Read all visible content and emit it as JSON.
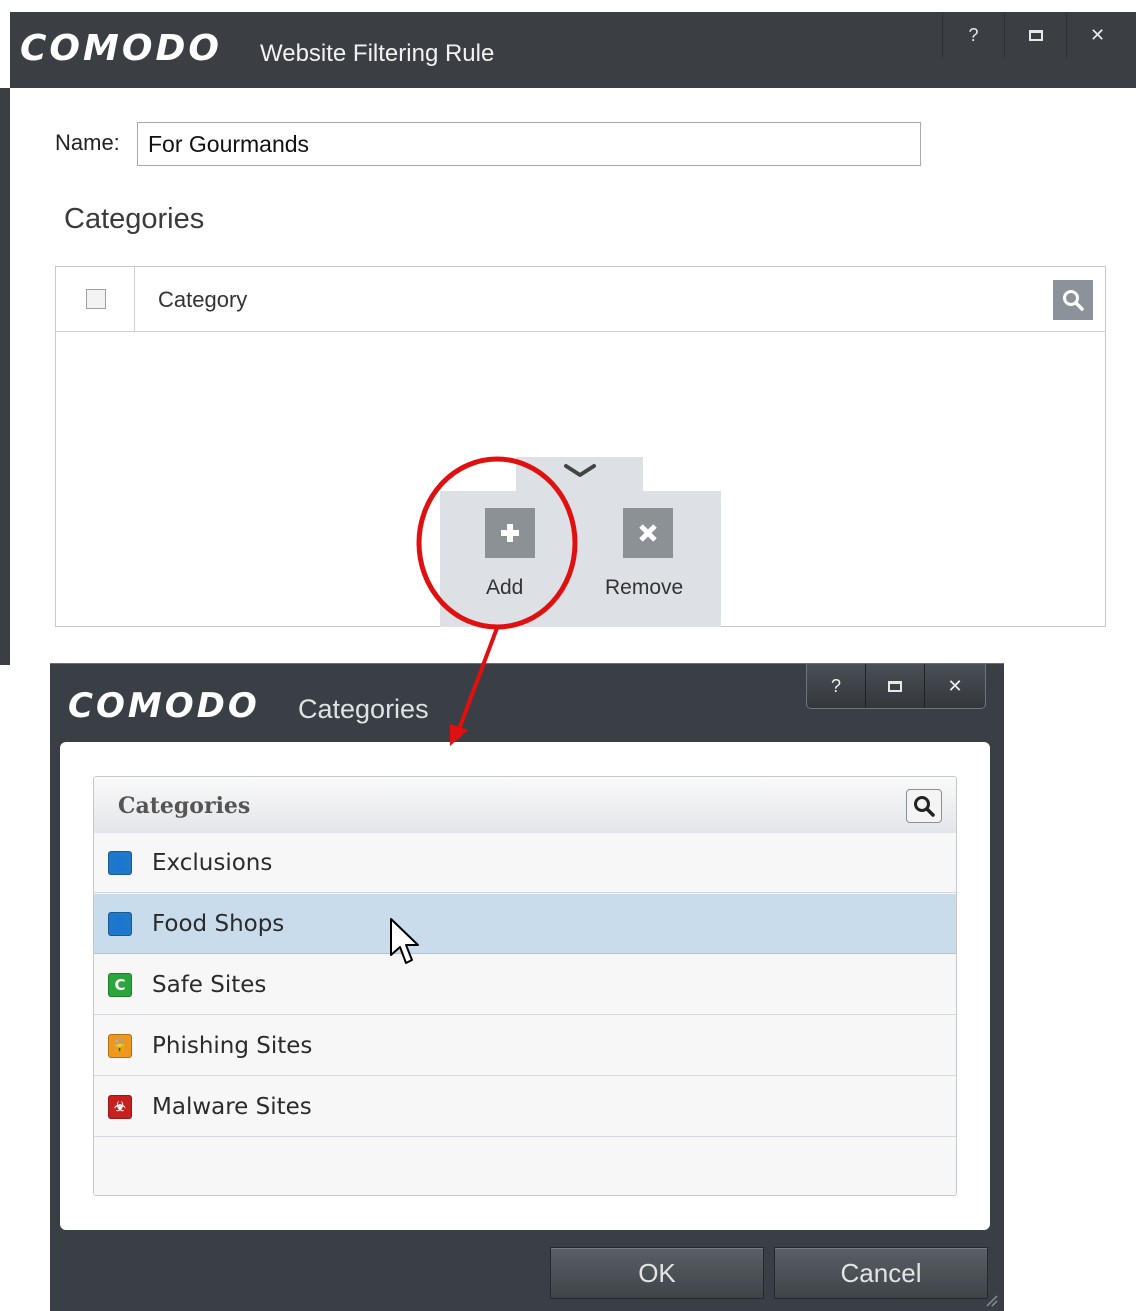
{
  "main_window": {
    "logo": "COMODO",
    "title": "Website Filtering Rule",
    "controls": {
      "help": "?",
      "close": "✕"
    },
    "name_label": "Name:",
    "name_value": "For Gourmands",
    "categories_heading": "Categories",
    "table": {
      "column_header": "Category"
    },
    "add_label": "Add",
    "remove_label": "Remove"
  },
  "categories_dialog": {
    "logo": "COMODO",
    "title": "Categories",
    "controls": {
      "help": "?",
      "close": "✕"
    },
    "list_header": "Categories",
    "rows": [
      {
        "label": "Exclusions",
        "icon": "user-icon",
        "icon_glyph": "👤",
        "icon_color": "#1f78c8",
        "selected": false
      },
      {
        "label": "Food Shops",
        "icon": "user-icon",
        "icon_glyph": "👤",
        "icon_color": "#1f78c8",
        "selected": true
      },
      {
        "label": "Safe Sites",
        "icon": "safe-c-icon",
        "icon_glyph": "C",
        "icon_color": "#2aa63a",
        "selected": false
      },
      {
        "label": "Phishing Sites",
        "icon": "lock-icon",
        "icon_glyph": "🔓",
        "icon_color": "#f0961e",
        "selected": false
      },
      {
        "label": "Malware Sites",
        "icon": "biohazard-icon",
        "icon_glyph": "☣",
        "icon_color": "#c8201e",
        "selected": false
      }
    ],
    "ok_label": "OK",
    "cancel_label": "Cancel"
  },
  "colors": {
    "titlebar": "#3b3f44",
    "selection": "#c8dcec",
    "callout": "#e01010"
  }
}
